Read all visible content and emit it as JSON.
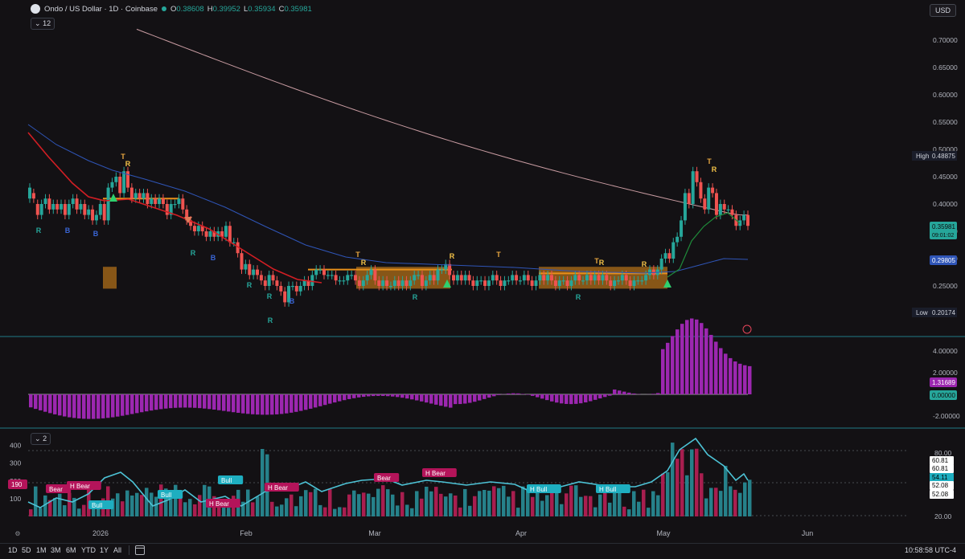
{
  "header": {
    "symbol": "Ondo / US Dollar · 1D · Coinbase",
    "open_label": "O",
    "open": "0.38608",
    "high_label": "H",
    "high": "0.39952",
    "low_label": "L",
    "low": "0.35934",
    "close_label": "C",
    "close": "0.35981",
    "indicator_count": "12",
    "currency": "USD"
  },
  "pane_labels": {
    "volume_indicator_count": "2"
  },
  "timeframes": [
    "1D",
    "5D",
    "1M",
    "3M",
    "6M",
    "YTD",
    "1Y",
    "All"
  ],
  "clock": "10:58:58 UTC-4",
  "colors": {
    "up": "#26a69a",
    "down": "#ef5350",
    "ma_red": "#d21e24",
    "ma_blue": "#2f55b7",
    "ma_pink": "#c99ca2",
    "ma_green": "#1f8a3a",
    "box": "#e8901a",
    "osc": "#9c27b0",
    "rsi": "#4dc3d6",
    "vol_up": "#26818a",
    "vol_down": "#a81e4f",
    "label_bull": "#1eaec0",
    "label_bear": "#b4145a",
    "marker_green": "#2ed06e"
  },
  "chart_data": [
    {
      "type": "candlestick",
      "title": "Ondo / US Dollar · 1D · Coinbase",
      "y_scale": "linear",
      "ylim": [
        0.17,
        0.75
      ],
      "y_ticks": [
        0.7,
        0.65,
        0.6,
        0.55,
        0.5,
        0.45,
        0.4,
        0.35,
        0.3,
        0.25
      ],
      "x_labels": [
        "2026",
        "Feb",
        "Mar",
        "Apr",
        "May",
        "Jun"
      ],
      "price_labels": [
        {
          "label": "High",
          "value": "0.48875"
        },
        {
          "label": "",
          "value": "0.35981",
          "sub": "09:01:02"
        },
        {
          "label": "",
          "value": "0.29805"
        },
        {
          "label": "Low",
          "value": "0.20174"
        }
      ],
      "candles_close": [
        0.43,
        0.41,
        0.38,
        0.4,
        0.41,
        0.39,
        0.4,
        0.39,
        0.4,
        0.38,
        0.4,
        0.41,
        0.39,
        0.4,
        0.38,
        0.39,
        0.37,
        0.38,
        0.4,
        0.37,
        0.43,
        0.44,
        0.45,
        0.42,
        0.46,
        0.43,
        0.41,
        0.42,
        0.41,
        0.42,
        0.4,
        0.41,
        0.4,
        0.41,
        0.4,
        0.38,
        0.4,
        0.4,
        0.41,
        0.39,
        0.37,
        0.36,
        0.35,
        0.36,
        0.35,
        0.34,
        0.35,
        0.34,
        0.35,
        0.34,
        0.36,
        0.33,
        0.33,
        0.31,
        0.28,
        0.29,
        0.27,
        0.28,
        0.27,
        0.26,
        0.25,
        0.27,
        0.26,
        0.25,
        0.24,
        0.22,
        0.25,
        0.25,
        0.24,
        0.25,
        0.26,
        0.25,
        0.27,
        0.28,
        0.28,
        0.27,
        0.27,
        0.27,
        0.26,
        0.26,
        0.26,
        0.27,
        0.27,
        0.26,
        0.25,
        0.26,
        0.27,
        0.28,
        0.26,
        0.25,
        0.26,
        0.25,
        0.25,
        0.26,
        0.25,
        0.26,
        0.25,
        0.26,
        0.27,
        0.27,
        0.25,
        0.26,
        0.27,
        0.26,
        0.28,
        0.28,
        0.29,
        0.27,
        0.26,
        0.27,
        0.26,
        0.27,
        0.26,
        0.25,
        0.26,
        0.26,
        0.25,
        0.26,
        0.27,
        0.26,
        0.25,
        0.26,
        0.26,
        0.27,
        0.26,
        0.26,
        0.27,
        0.26,
        0.25,
        0.26,
        0.27,
        0.26,
        0.27,
        0.26,
        0.25,
        0.26,
        0.26,
        0.25,
        0.26,
        0.27,
        0.26,
        0.26,
        0.27,
        0.26,
        0.27,
        0.26,
        0.27,
        0.26,
        0.25,
        0.26,
        0.26,
        0.27,
        0.26,
        0.25,
        0.26,
        0.26,
        0.26,
        0.27,
        0.28,
        0.27,
        0.28,
        0.3,
        0.31,
        0.3,
        0.33,
        0.34,
        0.37,
        0.42,
        0.4,
        0.46,
        0.44,
        0.41,
        0.39,
        0.43,
        0.42,
        0.38,
        0.4,
        0.39,
        0.39,
        0.38,
        0.36,
        0.37,
        0.38,
        0.36
      ],
      "candles_open": [
        0.41,
        0.42,
        0.4,
        0.38,
        0.4,
        0.41,
        0.39,
        0.4,
        0.39,
        0.4,
        0.38,
        0.4,
        0.41,
        0.39,
        0.4,
        0.38,
        0.39,
        0.37,
        0.38,
        0.4,
        0.37,
        0.43,
        0.44,
        0.45,
        0.42,
        0.46,
        0.43,
        0.41,
        0.42,
        0.41,
        0.42,
        0.4,
        0.41,
        0.4,
        0.41,
        0.4,
        0.38,
        0.4,
        0.4,
        0.41,
        0.39,
        0.37,
        0.36,
        0.35,
        0.36,
        0.35,
        0.34,
        0.35,
        0.34,
        0.35,
        0.34,
        0.36,
        0.33,
        0.33,
        0.31,
        0.28,
        0.29,
        0.27,
        0.28,
        0.27,
        0.26,
        0.25,
        0.27,
        0.26,
        0.25,
        0.24,
        0.22,
        0.25,
        0.25,
        0.24,
        0.25,
        0.26,
        0.25,
        0.27,
        0.28,
        0.28,
        0.27,
        0.27,
        0.27,
        0.26,
        0.26,
        0.26,
        0.27,
        0.27,
        0.26,
        0.25,
        0.26,
        0.27,
        0.28,
        0.26,
        0.25,
        0.26,
        0.25,
        0.25,
        0.26,
        0.25,
        0.26,
        0.25,
        0.26,
        0.27,
        0.27,
        0.25,
        0.26,
        0.27,
        0.26,
        0.28,
        0.28,
        0.29,
        0.27,
        0.26,
        0.27,
        0.26,
        0.27,
        0.26,
        0.25,
        0.26,
        0.26,
        0.25,
        0.26,
        0.27,
        0.26,
        0.25,
        0.26,
        0.26,
        0.27,
        0.26,
        0.26,
        0.27,
        0.26,
        0.25,
        0.26,
        0.27,
        0.26,
        0.27,
        0.26,
        0.25,
        0.26,
        0.26,
        0.25,
        0.26,
        0.27,
        0.26,
        0.26,
        0.27,
        0.26,
        0.27,
        0.26,
        0.27,
        0.26,
        0.25,
        0.26,
        0.26,
        0.27,
        0.26,
        0.25,
        0.26,
        0.26,
        0.26,
        0.27,
        0.28,
        0.27,
        0.28,
        0.3,
        0.31,
        0.3,
        0.33,
        0.34,
        0.37,
        0.42,
        0.4,
        0.46,
        0.44,
        0.41,
        0.39,
        0.43,
        0.42,
        0.38,
        0.4,
        0.39,
        0.39,
        0.38,
        0.36,
        0.37,
        0.38
      ],
      "labels": [
        {
          "i": 13,
          "text": "R",
          "pos": "below",
          "color": "#26a69a"
        },
        {
          "i": 48,
          "text": "B",
          "pos": "below",
          "color": "#3a66d6"
        },
        {
          "i": 86,
          "text": "B",
          "pos": "below",
          "color": "#3a66d6"
        },
        {
          "i": 115,
          "text": "T",
          "pos": "above",
          "color": "#e8a640"
        },
        {
          "i": 124,
          "text": "R",
          "pos": "above",
          "color": "#f3c247"
        },
        {
          "i": 196,
          "text": "R",
          "pos": "below",
          "color": "#26a69a"
        },
        {
          "i": 233,
          "text": "B",
          "pos": "below",
          "color": "#3a66d6"
        },
        {
          "i": 265,
          "text": "R",
          "pos": "below",
          "color": "#26a69a"
        },
        {
          "i": 282,
          "text": "R",
          "pos": "below",
          "color": "#26a69a"
        },
        {
          "i": 331,
          "text": "R",
          "pos": "below",
          "color": "#26a69a"
        },
        {
          "i": 361,
          "text": "B",
          "pos": "below",
          "color": "#3a66d6"
        },
        {
          "i": 389,
          "text": "T",
          "pos": "above",
          "color": "#e8a640"
        },
        {
          "i": 452,
          "text": "R",
          "pos": "above",
          "color": "#f3c247"
        },
        {
          "i": 516,
          "text": "R",
          "pos": "below",
          "color": "#26a69a"
        },
        {
          "i": 562,
          "text": "R",
          "pos": "above",
          "color": "#f3c247"
        },
        {
          "i": 620,
          "text": "T",
          "pos": "above",
          "color": "#e8a640"
        },
        {
          "i": 719,
          "text": "R",
          "pos": "below",
          "color": "#26a69a"
        },
        {
          "i": 742,
          "text": "T",
          "pos": "above",
          "color": "#e8a640"
        },
        {
          "i": 748,
          "text": "R",
          "pos": "above",
          "color": "#f3c247"
        },
        {
          "i": 800,
          "text": "R",
          "pos": "above",
          "color": "#f3c247"
        },
        {
          "i": 882,
          "text": "T",
          "pos": "above",
          "color": "#e8a640"
        },
        {
          "i": 888,
          "text": "R",
          "pos": "above",
          "color": "#f3c247"
        }
      ]
    },
    {
      "type": "bar",
      "title": "",
      "y_ticks": [
        4.0,
        2.0,
        -2.0
      ],
      "price_labels": [
        {
          "value": "1.31689"
        },
        {
          "value": "0.00000"
        }
      ],
      "ylim": [
        -3.0,
        5.6
      ]
    },
    {
      "type": "bar",
      "title": "",
      "left_ticks": [
        400,
        300,
        200,
        100
      ],
      "left_label": "190",
      "right_ticks": [
        80.0,
        20.0
      ],
      "right_labels": [
        "60.81",
        "60.81",
        "54.11",
        "52.08",
        "52.08"
      ],
      "tags": [
        {
          "text": "Bear",
          "kind": "bear"
        },
        {
          "text": "H Bear",
          "kind": "bear"
        },
        {
          "text": "Bull",
          "kind": "bull"
        },
        {
          "text": "Bull",
          "kind": "bull"
        },
        {
          "text": "H Bear",
          "kind": "bear"
        },
        {
          "text": "Bull",
          "kind": "bull"
        },
        {
          "text": "H Bear",
          "kind": "bear"
        },
        {
          "text": "Bear",
          "kind": "bear"
        },
        {
          "text": "H Bear",
          "kind": "bear"
        },
        {
          "text": "H Bull",
          "kind": "bull"
        },
        {
          "text": "H Bull",
          "kind": "bull"
        }
      ]
    }
  ]
}
